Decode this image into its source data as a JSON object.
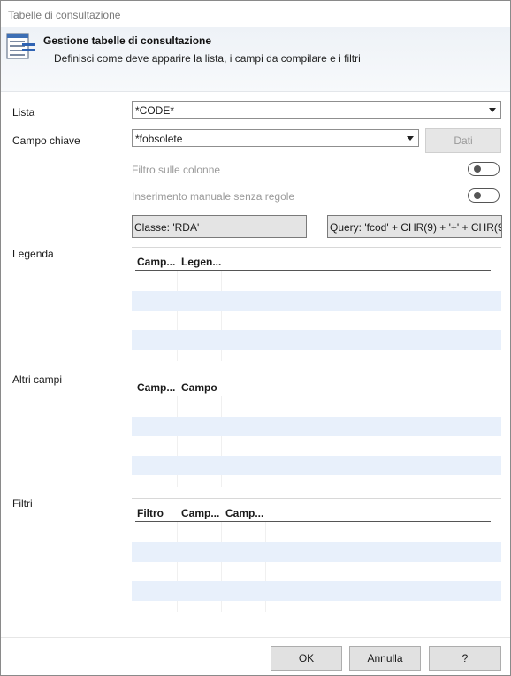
{
  "window": {
    "title": "Tabelle di consultazione"
  },
  "header": {
    "icon": "table-list-icon",
    "title": "Gestione tabelle di consultazione",
    "subtitle": "Definisci come deve apparire la lista, i campi da compilare e i filtri"
  },
  "form": {
    "lista_label": "Lista",
    "lista_value": "*CODE*",
    "campo_chiave_label": "Campo chiave",
    "campo_chiave_value": "*fobsolete",
    "dati_button": "Dati",
    "filtro_colonne_label": "Filtro sulle colonne",
    "filtro_colonne_on": false,
    "inserimento_label": "Inserimento manuale senza regole",
    "inserimento_on": false,
    "classe_text": "Classe: 'RDA'",
    "query_text": "Query: 'fcod' + CHR(9) + '+' + CHR(9"
  },
  "legenda": {
    "label": "Legenda",
    "columns": [
      "Camp...",
      "Legen..."
    ]
  },
  "altri_campi": {
    "label": "Altri campi",
    "columns": [
      "Camp...",
      "Campo"
    ]
  },
  "filtri": {
    "label": "Filtri",
    "columns": [
      "Filtro",
      "Camp...",
      "Camp..."
    ]
  },
  "footer": {
    "ok": "OK",
    "annulla": "Annulla",
    "help": "?"
  }
}
